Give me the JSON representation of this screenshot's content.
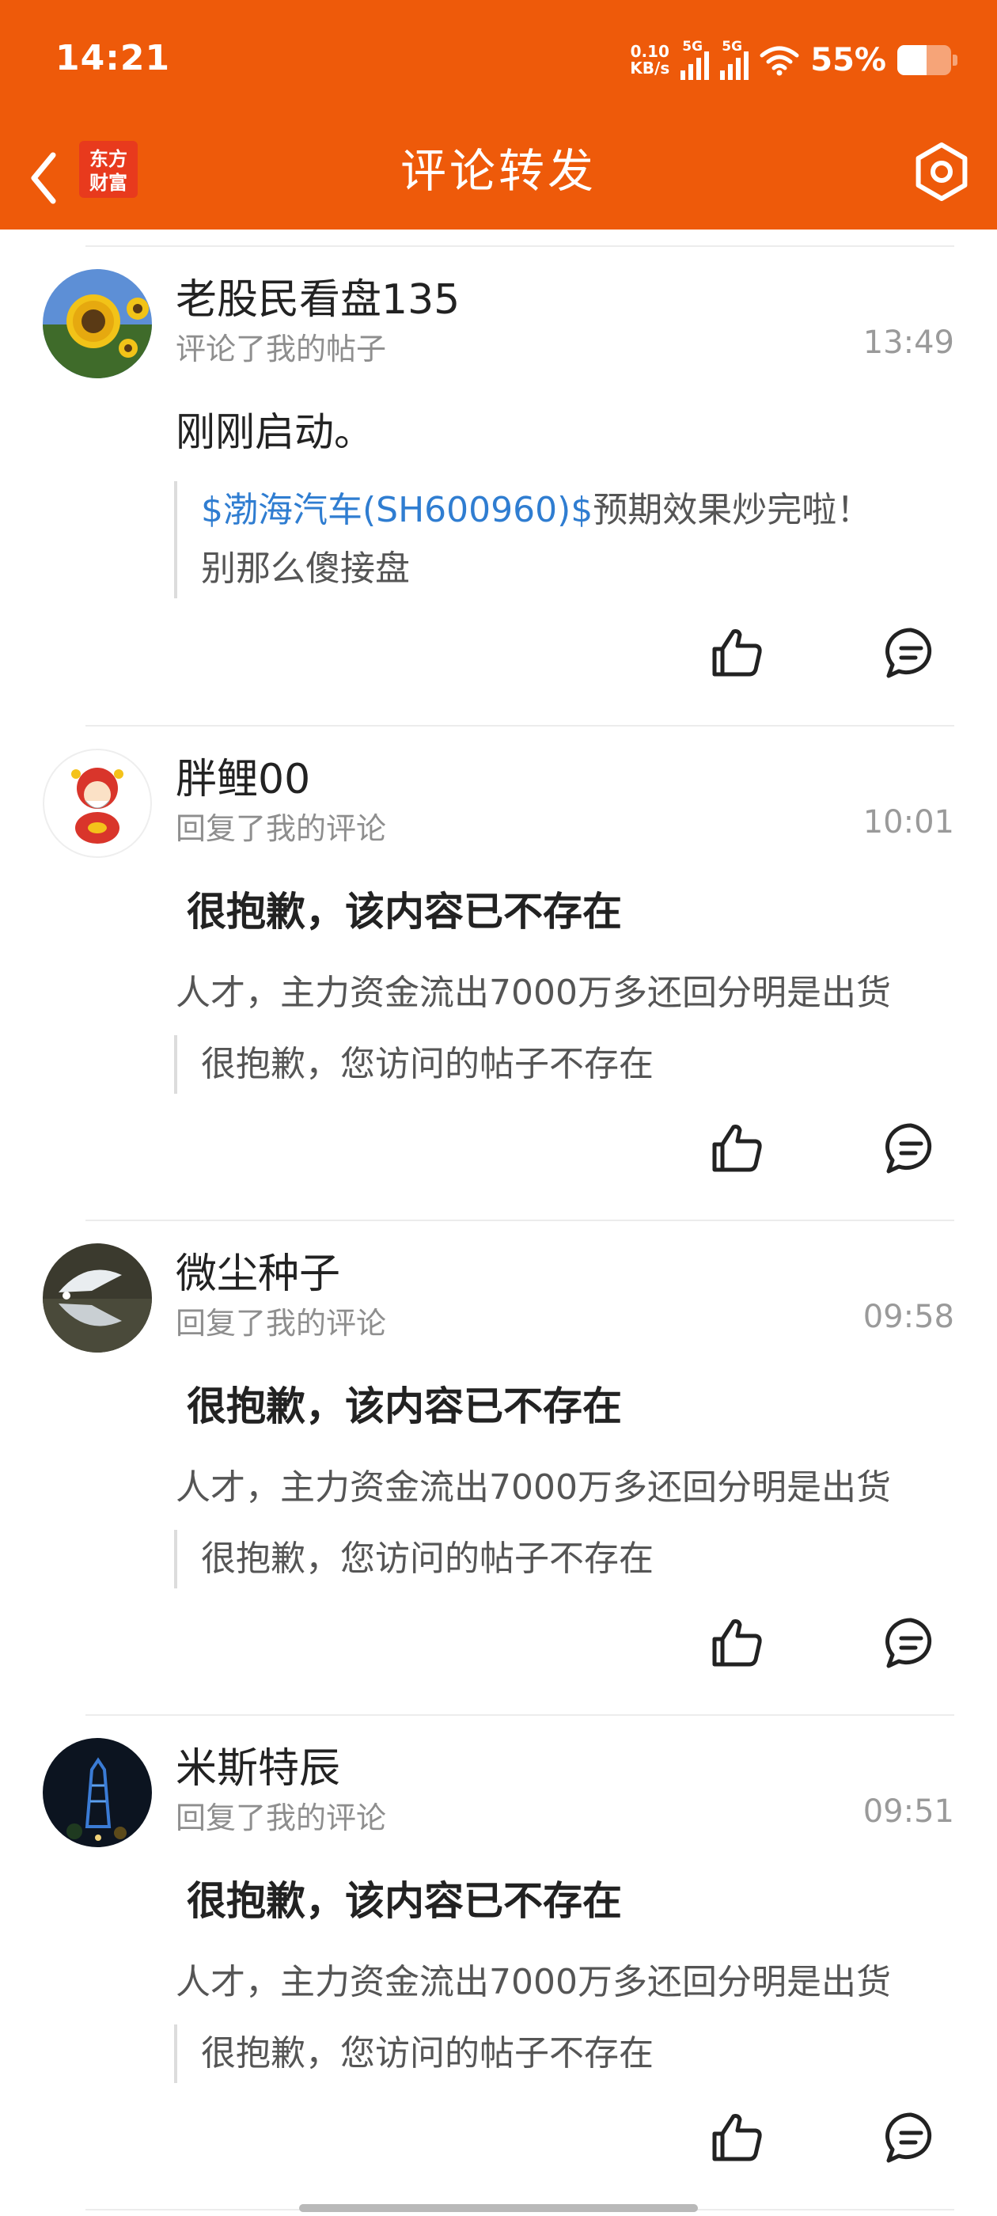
{
  "status_bar": {
    "time": "14:21",
    "net_speed_value": "0.10",
    "net_speed_unit": "KB/s",
    "signal1_label": "5G",
    "signal2_label": "5G",
    "battery_percent": "55%",
    "battery_level": 0.55
  },
  "header": {
    "logo_line1": "东方",
    "logo_line2": "财富",
    "title": "评论转发",
    "icons": [
      "back-icon",
      "settings-icon"
    ]
  },
  "notifications": [
    {
      "username": "老股民看盘135",
      "action": "评论了我的帖子",
      "time": "13:49",
      "comment": "刚刚启动。",
      "quote_stock": "$渤海汽车(SH600960)$",
      "quote_line1_rest": "预期效果炒完啦！",
      "quote_line2": "别那么傻接盘"
    },
    {
      "username": "胖鲤00",
      "action": "回复了我的评论",
      "time": "10:01",
      "comment": "很抱歉，该内容已不存在",
      "reply": "人才，主力资金流出7000万多还回分明是出货",
      "quote": "很抱歉，您访问的帖子不存在"
    },
    {
      "username": "微尘种子",
      "action": "回复了我的评论",
      "time": "09:58",
      "comment": "很抱歉，该内容已不存在",
      "reply": "人才，主力资金流出7000万多还回分明是出货",
      "quote": "很抱歉，您访问的帖子不存在"
    },
    {
      "username": "米斯特辰",
      "action": "回复了我的评论",
      "time": "09:51",
      "comment": "很抱歉，该内容已不存在",
      "reply": "人才，主力资金流出7000万多还回分明是出货",
      "quote": "很抱歉，您访问的帖子不存在"
    }
  ],
  "colors": {
    "header_bg": "#EE5A0A",
    "stock_link": "#2F7DD1",
    "logo_bg": "#E83A1D"
  }
}
